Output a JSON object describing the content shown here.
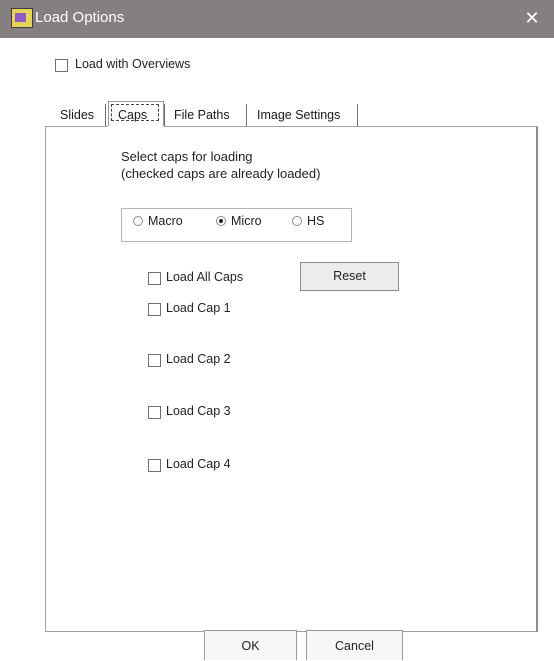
{
  "window": {
    "title": "Load Options",
    "close_glyph": "✕",
    "icon": "app-window-icon"
  },
  "load_with_overviews": {
    "label": "Load with Overviews",
    "checked": false
  },
  "tabs": [
    {
      "label": "Slides",
      "selected": false
    },
    {
      "label": "Caps",
      "selected": true
    },
    {
      "label": "File Paths",
      "selected": false
    },
    {
      "label": "Image Settings",
      "selected": false
    }
  ],
  "caps": {
    "instruction_line1": "Select caps for loading",
    "instruction_line2": "(checked caps are already loaded)",
    "mode_options": [
      {
        "label": "Macro",
        "selected": false
      },
      {
        "label": "Micro",
        "selected": true
      },
      {
        "label": "HS",
        "selected": false
      }
    ],
    "load_all": {
      "label": "Load All Caps",
      "checked": false
    },
    "reset_label": "Reset",
    "caps_list": [
      {
        "label": "Load Cap 1",
        "checked": false
      },
      {
        "label": "Load Cap 2",
        "checked": false
      },
      {
        "label": "Load Cap 3",
        "checked": false
      },
      {
        "label": "Load Cap 4",
        "checked": false
      }
    ]
  },
  "footer": {
    "ok_label": "OK",
    "cancel_label": "Cancel"
  }
}
